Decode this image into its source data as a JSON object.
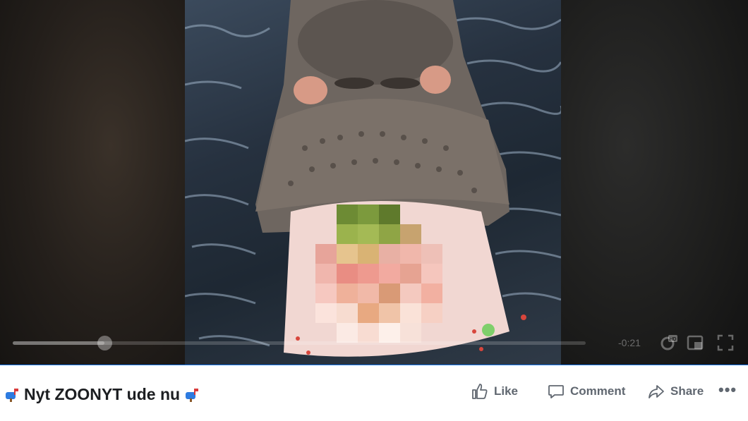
{
  "video": {
    "time_remaining": "-0:21",
    "progress_fraction": 0.16,
    "hd_badge": "HD",
    "colors": {
      "accent_bar": "#1877f2"
    }
  },
  "post": {
    "title": "Nyt ZOONYT ude nu",
    "title_emoji": "mailbox-with-flag"
  },
  "actions": {
    "like": "Like",
    "comment": "Comment",
    "share": "Share",
    "more": "•••"
  }
}
